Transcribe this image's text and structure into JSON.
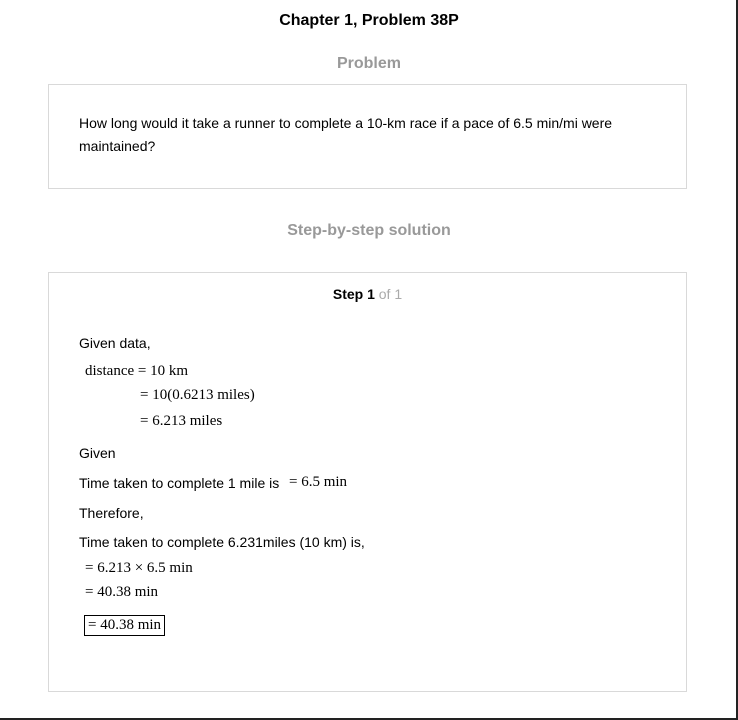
{
  "header": {
    "title": "Chapter 1, Problem 38P"
  },
  "problem": {
    "heading": "Problem",
    "text": "How long would it take a runner to complete a 10-km race if a pace of 6.5 min/mi were maintained?"
  },
  "solution": {
    "heading": "Step-by-step solution",
    "step_label": "Step 1",
    "step_of": "of 1",
    "given_data": "Given data,",
    "eq1": "distance = 10 km",
    "eq2": "= 10(0.6213 miles)",
    "eq3": "= 6.213 miles",
    "given": "Given",
    "time_text": "Time taken to complete 1 mile is",
    "time_eq": "= 6.5 min",
    "therefore": "Therefore,",
    "time_total_text": "Time taken to complete 6.231miles (10 km) is,",
    "eq4": "= 6.213 × 6.5 min",
    "eq5": "= 40.38 min",
    "answer": "= 40.38 min"
  }
}
